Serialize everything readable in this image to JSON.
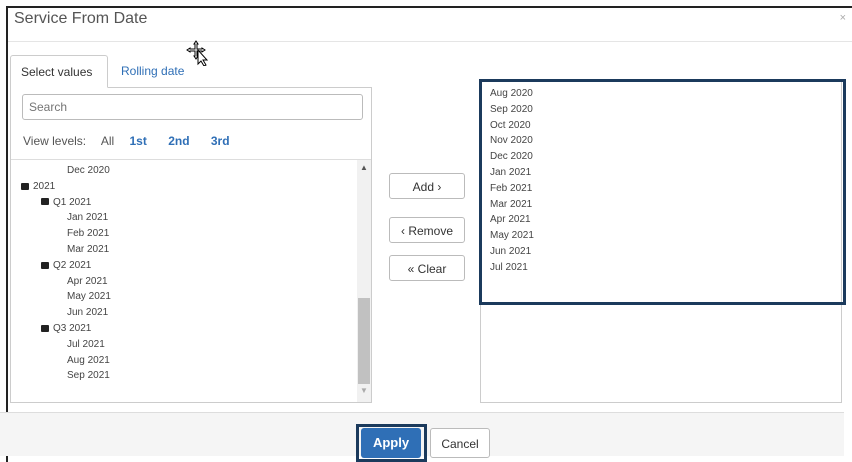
{
  "dialog": {
    "title": "Service From Date",
    "close_glyph": "×"
  },
  "tabs": [
    {
      "label": "Select values",
      "active": true
    },
    {
      "label": "Rolling date",
      "active": false
    }
  ],
  "search": {
    "placeholder": "Search"
  },
  "view_levels": {
    "label": "View levels:",
    "options": [
      "All",
      "1st",
      "2nd",
      "3rd"
    ]
  },
  "tree": {
    "rows": [
      {
        "text": "Dec 2020",
        "level": 3,
        "icon": false
      },
      {
        "text": "2021",
        "level": 1,
        "icon": true
      },
      {
        "text": "Q1 2021",
        "level": 2,
        "icon": true
      },
      {
        "text": "Jan 2021",
        "level": 3,
        "icon": false
      },
      {
        "text": "Feb 2021",
        "level": 3,
        "icon": false
      },
      {
        "text": "Mar 2021",
        "level": 3,
        "icon": false
      },
      {
        "text": "Q2 2021",
        "level": 2,
        "icon": true
      },
      {
        "text": "Apr 2021",
        "level": 3,
        "icon": false
      },
      {
        "text": "May 2021",
        "level": 3,
        "icon": false
      },
      {
        "text": "Jun 2021",
        "level": 3,
        "icon": false
      },
      {
        "text": "Q3 2021",
        "level": 2,
        "icon": true
      },
      {
        "text": "Jul 2021",
        "level": 3,
        "icon": false
      },
      {
        "text": "Aug 2021",
        "level": 3,
        "icon": false
      },
      {
        "text": "Sep 2021",
        "level": 3,
        "icon": false
      }
    ]
  },
  "buttons": {
    "add": "Add ›",
    "remove": "‹ Remove",
    "clear": "« Clear",
    "apply": "Apply",
    "cancel": "Cancel"
  },
  "selected": [
    "Aug 2020",
    "Sep 2020",
    "Oct 2020",
    "Nov 2020",
    "Dec 2020",
    "Jan 2021",
    "Feb 2021",
    "Mar 2021",
    "Apr 2021",
    "May 2021",
    "Jun 2021",
    "Jul 2021"
  ],
  "colors": {
    "accent": "#2f6fb6",
    "highlight_border": "#1b3a5c"
  }
}
